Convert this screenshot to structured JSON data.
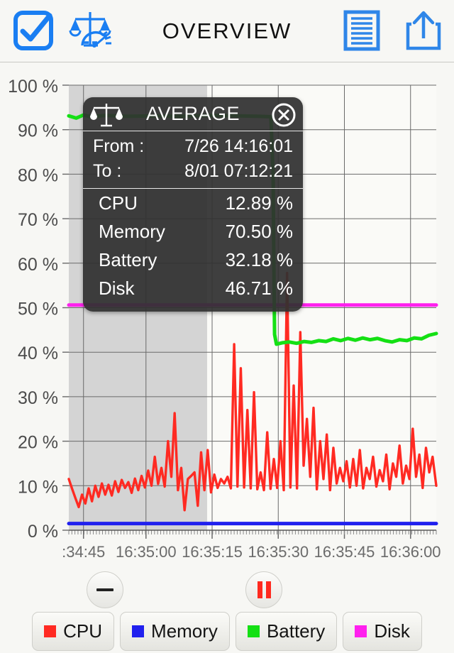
{
  "header": {
    "title": "OVERVIEW",
    "icons": [
      {
        "name": "checkbox-checked-icon",
        "label": "select"
      },
      {
        "name": "scale-gauge-icon",
        "label": "average"
      },
      {
        "name": "log-document-icon",
        "label": "log"
      },
      {
        "name": "share-upload-icon",
        "label": "share"
      }
    ]
  },
  "average_panel": {
    "title": "AVERAGE",
    "scale_icon": "balance-scale-icon",
    "close_icon": "close-circle-icon",
    "from_label": "From :",
    "from_value": "7/26 14:16:01",
    "to_label": "To :",
    "to_value": "  8/01 07:12:21",
    "stats": [
      {
        "label": "CPU",
        "value": "12.89 %"
      },
      {
        "label": "Memory",
        "value": "70.50 %"
      },
      {
        "label": "Battery",
        "value": "32.18 %"
      },
      {
        "label": "Disk",
        "value": "46.71 %"
      }
    ]
  },
  "controls": {
    "zoom_out": "minus-icon",
    "pause": "pause-icon"
  },
  "legend": {
    "items": [
      {
        "label": "CPU",
        "color": "#ff2a22"
      },
      {
        "label": "Memory",
        "color": "#2020ee"
      },
      {
        "label": "Battery",
        "color": "#14e014"
      },
      {
        "label": "Disk",
        "color": "#ff20ee"
      }
    ]
  },
  "chart_data": {
    "type": "line",
    "title": "OVERVIEW",
    "xlabel": "",
    "ylabel": "%",
    "ylim": [
      0,
      100
    ],
    "ytick_labels": [
      "0 %",
      "10 %",
      "20 %",
      "30 %",
      "40 %",
      "50 %",
      "60 %",
      "70 %",
      "80 %",
      "90 %",
      "100 %"
    ],
    "ytick_values": [
      0,
      10,
      20,
      30,
      40,
      50,
      60,
      70,
      80,
      90,
      100
    ],
    "xtick_labels": [
      ":34:45",
      "16:35:00",
      "16:35:15",
      "16:35:30",
      "16:35:45",
      "16:36:00"
    ],
    "xtick_positions": [
      0.04,
      0.21,
      0.39,
      0.57,
      0.75,
      0.93
    ],
    "grid": true,
    "legend_position": "bottom",
    "selection": {
      "from_frac": 0.0,
      "to_frac": 0.3764,
      "color": "#d4d4d4"
    },
    "series": [
      {
        "name": "CPU",
        "color": "#ff2a22",
        "x": [
          0,
          0.009,
          0.018,
          0.027,
          0.036,
          0.045,
          0.054,
          0.063,
          0.072,
          0.081,
          0.09,
          0.099,
          0.108,
          0.117,
          0.126,
          0.135,
          0.144,
          0.153,
          0.162,
          0.171,
          0.18,
          0.189,
          0.198,
          0.207,
          0.216,
          0.225,
          0.234,
          0.243,
          0.252,
          0.261,
          0.27,
          0.279,
          0.288,
          0.297,
          0.306,
          0.315,
          0.324,
          0.333,
          0.342,
          0.351,
          0.36,
          0.369,
          0.378,
          0.387,
          0.396,
          0.405,
          0.414,
          0.423,
          0.432,
          0.441,
          0.45,
          0.459,
          0.468,
          0.477,
          0.486,
          0.495,
          0.504,
          0.513,
          0.522,
          0.531,
          0.54,
          0.549,
          0.558,
          0.567,
          0.576,
          0.585,
          0.594,
          0.603,
          0.612,
          0.621,
          0.63,
          0.639,
          0.648,
          0.657,
          0.666,
          0.675,
          0.684,
          0.693,
          0.702,
          0.711,
          0.72,
          0.729,
          0.738,
          0.747,
          0.756,
          0.765,
          0.774,
          0.783,
          0.792,
          0.801,
          0.81,
          0.819,
          0.828,
          0.837,
          0.846,
          0.855,
          0.864,
          0.873,
          0.882,
          0.891,
          0.9,
          0.909,
          0.918,
          0.927,
          0.936,
          0.945,
          0.954,
          0.963,
          0.972,
          0.981,
          0.99,
          1.0
        ],
        "y": [
          11.5,
          9.3,
          7.2,
          5.2,
          8.0,
          6.0,
          9.4,
          6.5,
          10.0,
          7.5,
          10.5,
          8.0,
          10.2,
          7.8,
          11.0,
          8.6,
          11.3,
          9.5,
          10.8,
          8.4,
          11.6,
          9.0,
          12.2,
          9.6,
          13.4,
          10.0,
          16.5,
          10.4,
          14.0,
          9.8,
          20.0,
          12.0,
          26.3,
          9.0,
          14.0,
          4.5,
          11.5,
          12.2,
          13.0,
          5.5,
          17.5,
          9.0,
          18.0,
          8.5,
          12.5,
          9.5,
          11.5,
          10.5,
          12.0,
          9.4,
          41.8,
          9.8,
          36.4,
          9.6,
          27.0,
          9.4,
          31.0,
          9.2,
          13.0,
          9.0,
          22.0,
          9.3,
          16.0,
          9.5,
          20.0,
          9.0,
          57.8,
          9.6,
          32.5,
          9.4,
          44.5,
          14.5,
          25.0,
          12.0,
          27.5,
          9.2,
          20.0,
          11.5,
          21.5,
          9.0,
          18.5,
          10.5,
          14.0,
          11.0,
          15.5,
          9.6,
          16.0,
          10.0,
          18.0,
          9.4,
          14.0,
          11.5,
          16.5,
          9.8,
          13.5,
          11.0,
          17.0,
          9.2,
          15.0,
          12.0,
          19.0,
          10.5,
          14.5,
          11.5,
          22.8,
          12.0,
          17.0,
          9.5,
          18.5,
          13.0,
          16.5,
          10.0
        ]
      },
      {
        "name": "Memory",
        "color": "#2020ee",
        "x": [
          0,
          0.25,
          0.5,
          0.75,
          1.0
        ],
        "y": [
          1.5,
          1.5,
          1.5,
          1.5,
          1.5
        ]
      },
      {
        "name": "Battery",
        "color": "#14e014",
        "x": [
          0,
          0.02,
          0.04,
          0.06,
          0.1,
          0.16,
          0.22,
          0.3,
          0.38,
          0.46,
          0.52,
          0.55,
          0.556,
          0.558,
          0.56,
          0.565,
          0.58,
          0.6,
          0.62,
          0.64,
          0.66,
          0.68,
          0.7,
          0.72,
          0.74,
          0.76,
          0.78,
          0.8,
          0.82,
          0.84,
          0.86,
          0.88,
          0.9,
          0.92,
          0.94,
          0.96,
          0.98,
          1.0
        ],
        "y": [
          93.1,
          92.6,
          93.3,
          92.9,
          93.2,
          93.0,
          93.1,
          93.0,
          93.2,
          93.1,
          93.0,
          92.9,
          80.0,
          60.0,
          44.0,
          41.8,
          42.1,
          42.3,
          42.0,
          42.4,
          42.2,
          42.6,
          42.4,
          43.0,
          42.6,
          43.1,
          42.7,
          43.2,
          42.8,
          43.1,
          42.6,
          42.3,
          42.8,
          42.6,
          43.2,
          43.0,
          43.8,
          44.2
        ]
      },
      {
        "name": "Disk",
        "color": "#ff20ee",
        "x": [
          0,
          0.25,
          0.5,
          0.75,
          1.0
        ],
        "y": [
          50.6,
          50.6,
          50.6,
          50.6,
          50.6
        ]
      }
    ]
  }
}
